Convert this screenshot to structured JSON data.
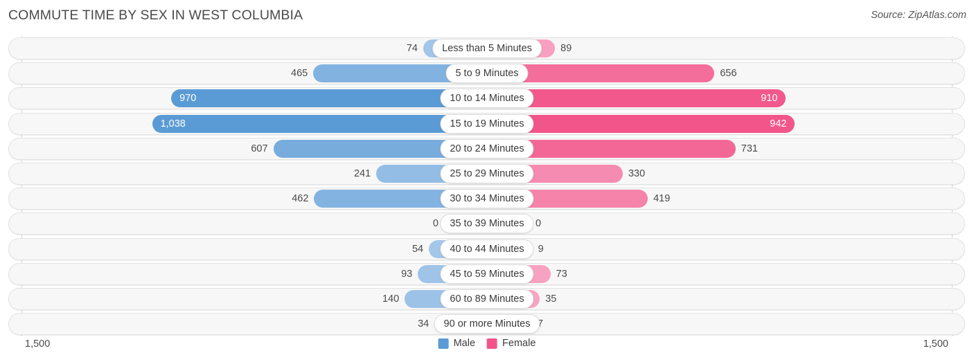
{
  "header": {
    "title": "COMMUTE TIME BY SEX IN WEST COLUMBIA",
    "source": "Source: ZipAtlas.com"
  },
  "axis": {
    "left_label": "1,500",
    "right_label": "1,500",
    "max": 1500
  },
  "legend": {
    "items": [
      {
        "label": "Male",
        "color": "#5b9bd5"
      },
      {
        "label": "Female",
        "color": "#f2548a"
      }
    ]
  },
  "colors": {
    "male_strong": "#5b9bd5",
    "male_weak": "#a8c9ea",
    "female_strong": "#f2548a",
    "female_weak": "#f7a8c4",
    "track_fill": "#f7f7f7",
    "track_border": "#e2e2e2",
    "gridline": "#d8d8d8",
    "text": "#3c3c3c"
  },
  "chart_data": {
    "type": "bar",
    "subtype": "diverging-bar",
    "title": "COMMUTE TIME BY SEX IN WEST COLUMBIA",
    "xlabel": "",
    "ylabel": "",
    "xlim": [
      -1500,
      1500
    ],
    "grid": true,
    "legend_position": "bottom-center",
    "categories": [
      "Less than 5 Minutes",
      "5 to 9 Minutes",
      "10 to 14 Minutes",
      "15 to 19 Minutes",
      "20 to 24 Minutes",
      "25 to 29 Minutes",
      "30 to 34 Minutes",
      "35 to 39 Minutes",
      "40 to 44 Minutes",
      "45 to 59 Minutes",
      "60 to 89 Minutes",
      "90 or more Minutes"
    ],
    "series": [
      {
        "name": "Male",
        "direction": "left",
        "values": [
          74,
          465,
          970,
          1038,
          607,
          241,
          462,
          0,
          54,
          93,
          140,
          34
        ],
        "labels": [
          "74",
          "465",
          "970",
          "1,038",
          "607",
          "241",
          "462",
          "0",
          "54",
          "93",
          "140",
          "34"
        ]
      },
      {
        "name": "Female",
        "direction": "right",
        "values": [
          89,
          656,
          910,
          942,
          731,
          330,
          419,
          0,
          9,
          73,
          35,
          7
        ],
        "labels": [
          "89",
          "656",
          "910",
          "942",
          "731",
          "330",
          "419",
          "0",
          "9",
          "73",
          "35",
          "7"
        ]
      }
    ]
  }
}
